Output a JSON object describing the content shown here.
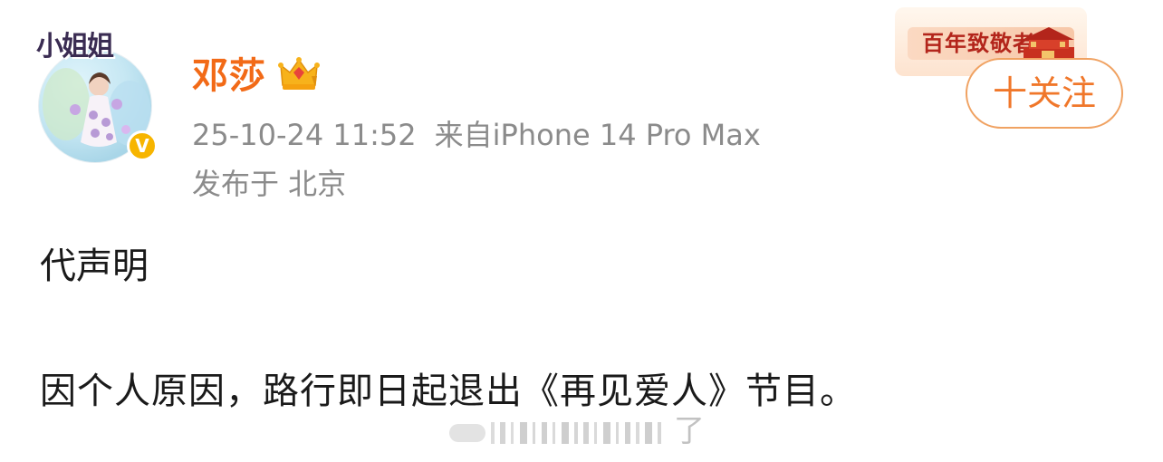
{
  "profile": {
    "avatar_frame_text": "小姐姐",
    "username": "邓莎",
    "verified_mark": "V"
  },
  "meta": {
    "timestamp": "25-10-24 11:52",
    "source": "来自iPhone 14 Pro Max",
    "location": "发布于 北京"
  },
  "badge": {
    "label": "百年致敬者"
  },
  "follow_button": {
    "label": "十关注"
  },
  "post": {
    "line1": "代声明",
    "line2": "因个人原因，路行即日起退出《再见爱人》节目。"
  },
  "watermark": {
    "tail_text": "了"
  },
  "colors": {
    "username": "#f26a17",
    "follow_accent": "#f0772a",
    "meta_text": "#8b8b8b",
    "verified": "#f7b500",
    "badge_text": "#b3251b"
  },
  "icons": {
    "crown": "crown-icon",
    "verified": "verified-icon",
    "gate": "gate-icon"
  }
}
